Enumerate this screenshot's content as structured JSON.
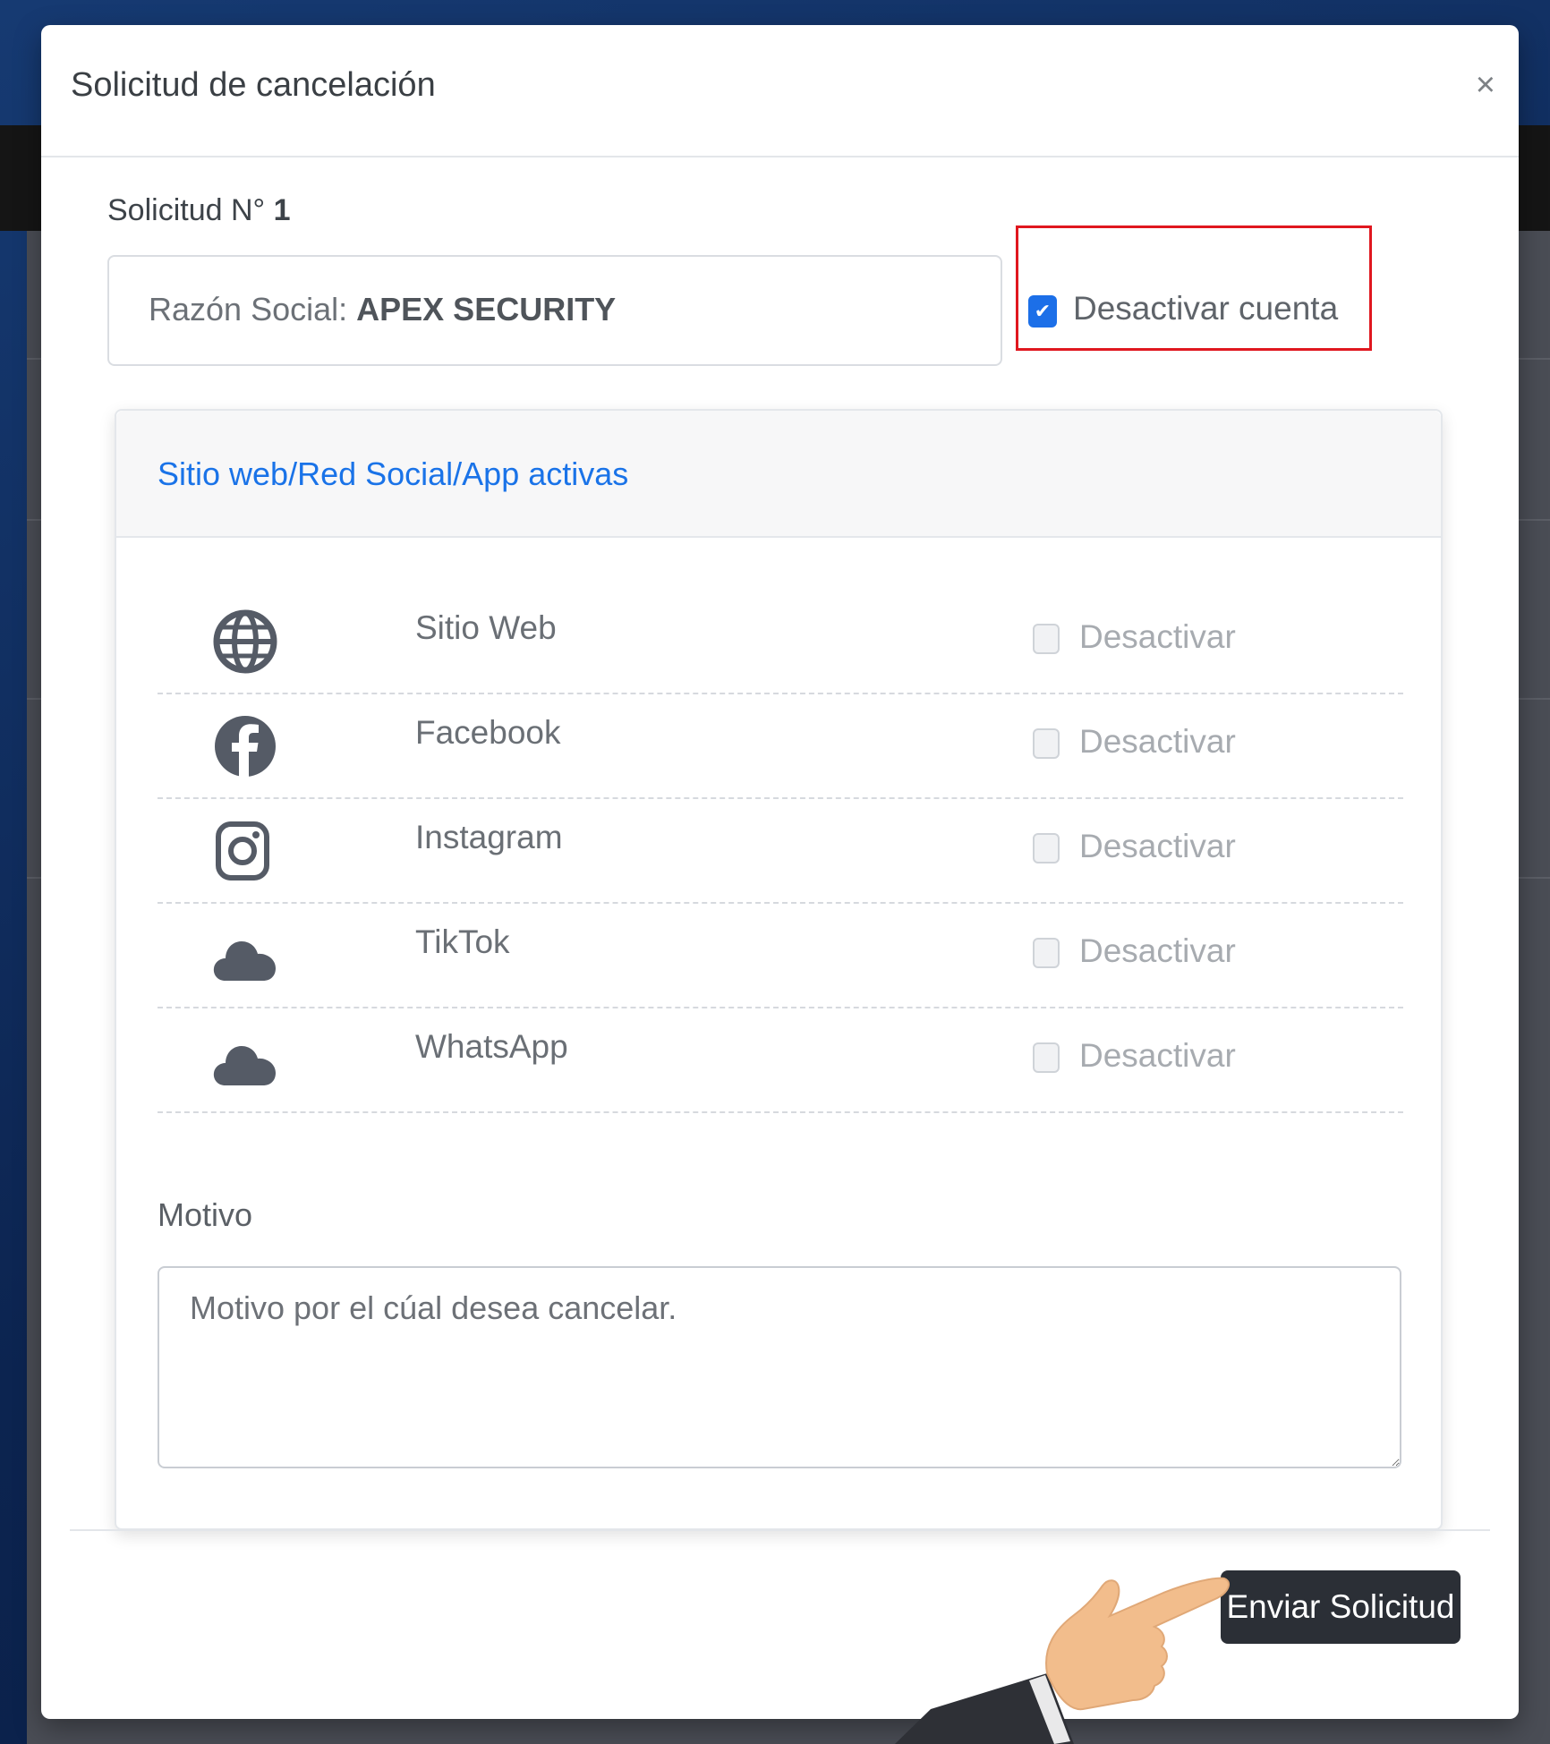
{
  "modal": {
    "title": "Solicitud de cancelación",
    "close_label": "×",
    "request_label": "Solicitud N°",
    "request_number": "1",
    "company_label": "Razón Social:",
    "company_name": "APEX SECURITY",
    "deactivate_account_label": "Desactivar cuenta",
    "deactivate_account_checked": true
  },
  "platforms": {
    "title": "Sitio web/Red Social/App activas",
    "items": [
      {
        "name": "Sitio Web",
        "icon": "globe-icon",
        "check_label": "Desactivar",
        "checked": false
      },
      {
        "name": "Facebook",
        "icon": "facebook-icon",
        "check_label": "Desactivar",
        "checked": false
      },
      {
        "name": "Instagram",
        "icon": "instagram-icon",
        "check_label": "Desactivar",
        "checked": false
      },
      {
        "name": "TikTok",
        "icon": "cloud-icon",
        "check_label": "Desactivar",
        "checked": false
      },
      {
        "name": "WhatsApp",
        "icon": "cloud-icon",
        "check_label": "Desactivar",
        "checked": false
      }
    ]
  },
  "reason": {
    "label": "Motivo",
    "placeholder": "Motivo por el cúal desea cancelar."
  },
  "footer": {
    "submit_label": "Enviar Solicitud"
  },
  "colors": {
    "accent": "#1a73e8",
    "checkbox_checked": "#1c6fe8",
    "highlight": "#e0171f",
    "button": "#2b2f36"
  }
}
